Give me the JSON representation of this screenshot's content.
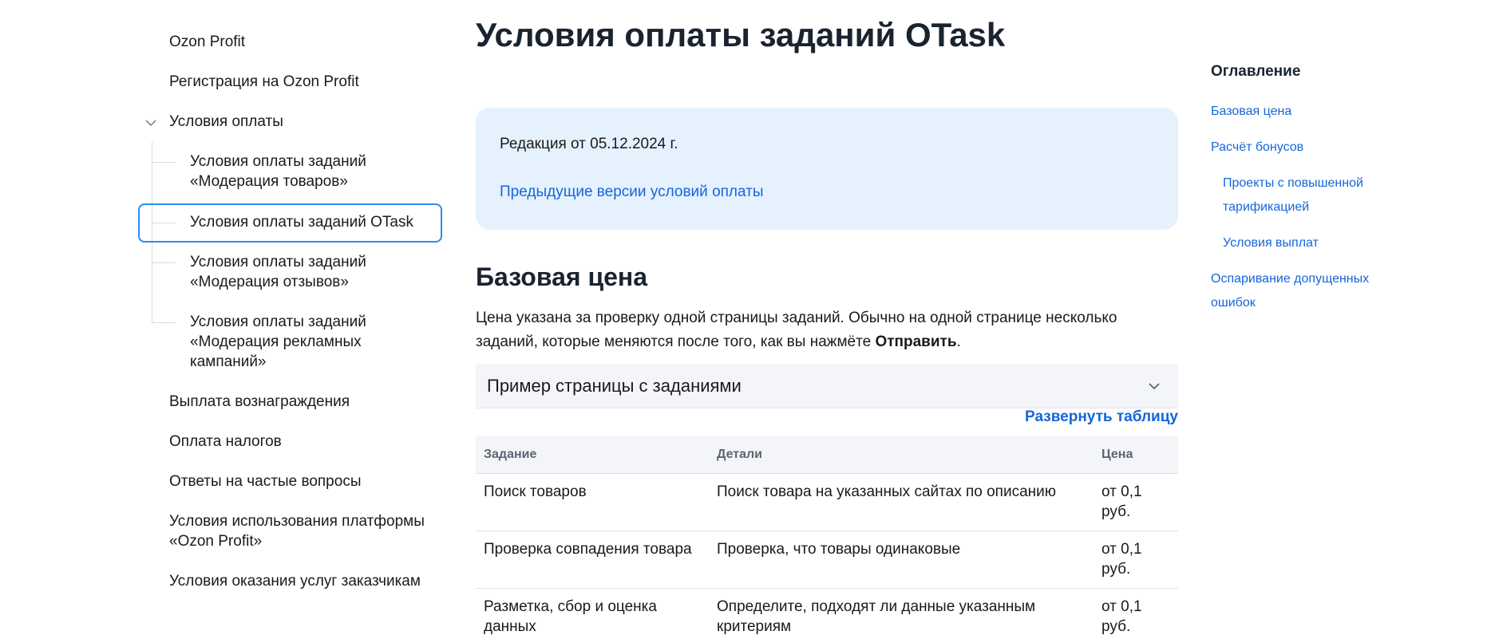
{
  "sidebar": {
    "items": [
      {
        "label": "Ozon Profit"
      },
      {
        "label": "Регистрация на Ozon Profit"
      },
      {
        "label": "Условия оплаты"
      },
      {
        "label": "Выплата вознаграждения"
      },
      {
        "label": "Оплата налогов"
      },
      {
        "label": "Ответы на частые вопросы"
      },
      {
        "label": "Условия использования платформы «Ozon Profit»"
      },
      {
        "label": "Условия оказания услуг заказчикам"
      }
    ],
    "sub_items": [
      {
        "label": "Условия оплаты заданий «Модерация товаров»"
      },
      {
        "label": "Условия оплаты заданий OTask"
      },
      {
        "label": "Условия оплаты заданий «Модерация отзывов»"
      },
      {
        "label": "Условия оплаты заданий «Модерация рекламных кампаний»"
      }
    ],
    "active_sub_item": "Условия оплаты заданий OTask"
  },
  "main": {
    "title": "Условия оплаты заданий OTask",
    "info_box": {
      "date": "Редакция от 05.12.2024 г.",
      "link": "Предыдущие версии условий оплаты"
    },
    "section": {
      "title": "Базовая цена",
      "text_part1": "Цена указана за проверку одной страницы заданий. Обычно на одной странице несколько заданий, которые меняются после того, как вы нажмёте ",
      "text_bold": "Отправить",
      "text_part2": "."
    },
    "accordion": {
      "label": "Пример страницы с заданиями"
    },
    "expand_link": "Развернуть таблицу",
    "table": {
      "headers": [
        "Задание",
        "Детали",
        "Цена"
      ],
      "rows": [
        {
          "task": "Поиск товаров",
          "details": "Поиск товара на указанных сайтах по описанию",
          "price": "от 0,1 руб."
        },
        {
          "task": "Проверка совпадения товара",
          "details": "Проверка, что товары одинаковые",
          "price": "от 0,1 руб."
        },
        {
          "task": "Разметка, сбор и оценка данных",
          "details": "Определите, подходят ли данные указанным критериям",
          "price": "от 0,1 руб."
        }
      ]
    }
  },
  "toc": {
    "title": "Оглавление",
    "links": [
      {
        "label": "Базовая цена"
      },
      {
        "label": "Расчёт бонусов"
      },
      {
        "label": "Проекты с повышенной тарификацией"
      },
      {
        "label": "Условия выплат"
      },
      {
        "label": "Оспаривание допущенных ошибок"
      }
    ]
  },
  "colors": {
    "accent": "#1466d9",
    "active_border": "#2b8cf0",
    "info_bg": "#e6f1fe"
  }
}
